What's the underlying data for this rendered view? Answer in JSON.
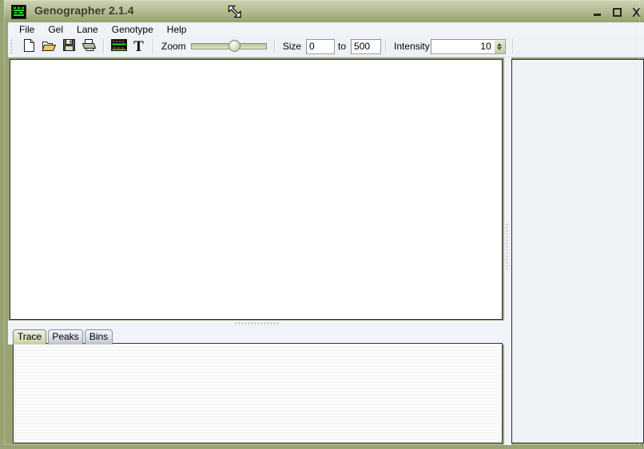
{
  "window": {
    "title": "Genographer 2.1.4",
    "app_icon": "gel-lanes-icon",
    "cursor": "resize-nwse-cursor",
    "frame_color": "#9aa373",
    "titlebar_color": "#b4bd94",
    "controls": {
      "minimize": "minimize-button",
      "maximize": "maximize-button",
      "close": "close-button"
    }
  },
  "menubar": {
    "items": [
      {
        "label": "File"
      },
      {
        "label": "Gel"
      },
      {
        "label": "Lane"
      },
      {
        "label": "Genotype"
      },
      {
        "label": "Help"
      }
    ]
  },
  "toolbar": {
    "grip": "toolbar-drag-grip",
    "buttons": [
      {
        "name": "new-file-button",
        "icon": "new-document-icon"
      },
      {
        "name": "open-file-button",
        "icon": "open-folder-icon"
      },
      {
        "name": "save-file-button",
        "icon": "floppy-disk-icon"
      },
      {
        "name": "print-button",
        "icon": "printer-icon"
      },
      {
        "name": "gel-view-button",
        "icon": "gel-image-icon"
      },
      {
        "name": "text-tool-button",
        "icon": "text-T-icon"
      }
    ],
    "zoom": {
      "label": "Zoom",
      "value": 55,
      "min": 0,
      "max": 100
    },
    "size": {
      "label": "Size",
      "from_value": "0",
      "to_label": "to",
      "to_value": "500"
    },
    "intensity": {
      "label": "Intensity",
      "value": "10",
      "spinner_up": "spin-up-arrow",
      "spinner_down": "spin-down-arrow"
    }
  },
  "main": {
    "gel_canvas": {
      "name": "gel-image-canvas",
      "background": "#ffffff",
      "content": ""
    },
    "horizontal_splitter": "horizontal-splitter-grip",
    "vertical_splitter": "vertical-splitter-grip",
    "tabs": [
      {
        "label": "Trace",
        "selected": true
      },
      {
        "label": "Peaks",
        "selected": false
      },
      {
        "label": "Bins",
        "selected": false
      }
    ],
    "tab_panel": {
      "name": "trace-panel",
      "content": ""
    },
    "right_panel": {
      "name": "lane-list-panel",
      "content": ""
    }
  }
}
